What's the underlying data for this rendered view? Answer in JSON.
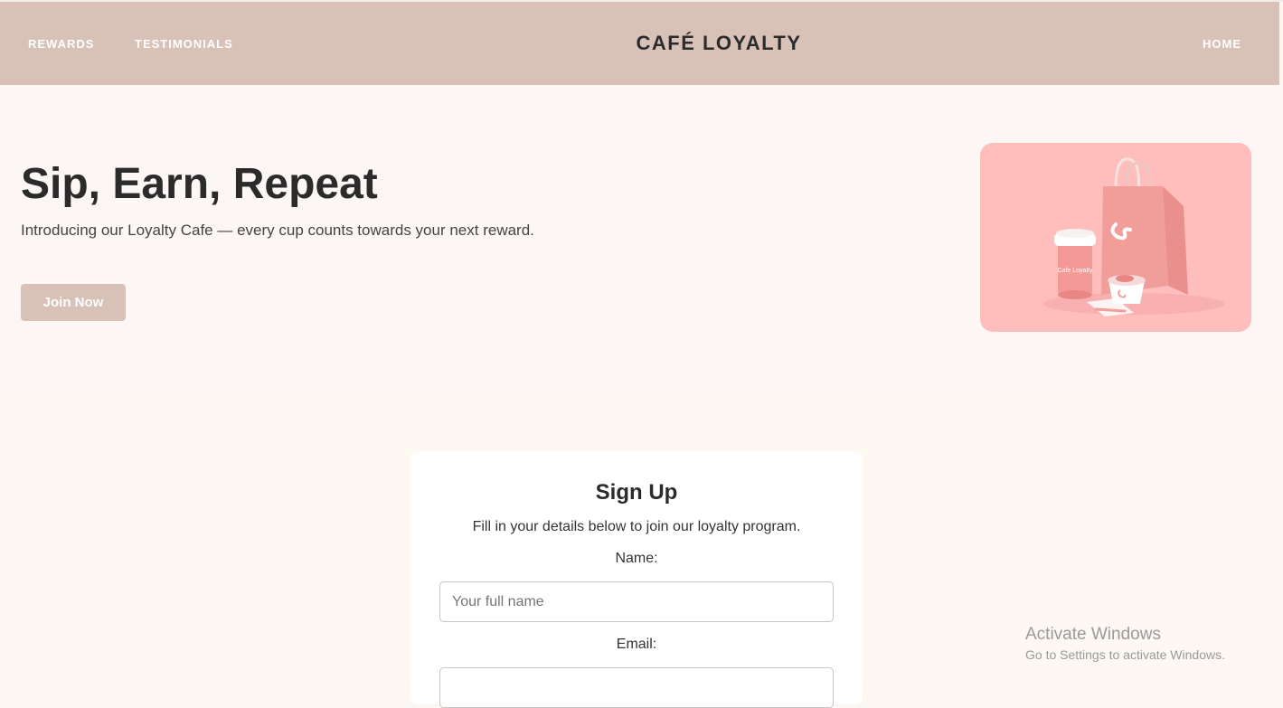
{
  "nav": {
    "rewards": "REWARDS",
    "testimonials": "TESTIMONIALS",
    "brand": "CAFÉ LOYALTY",
    "home": "HOME"
  },
  "hero": {
    "title": "Sip, Earn, Repeat",
    "subtitle": "Introducing our Loyalty Cafe — every cup counts towards your next reward.",
    "cta": "Join Now",
    "image_alt": "pink-cafe-merchandise-image",
    "cup_text": "Cafe Loyalty",
    "image_bg": "#ffbdbb"
  },
  "signup": {
    "title": "Sign Up",
    "description": "Fill in your details below to join our loyalty program.",
    "name_label": "Name:",
    "name_placeholder": "Your full name",
    "email_label": "Email:",
    "email_placeholder": ""
  },
  "watermark": {
    "line1": "Activate Windows",
    "line2": "Go to Settings to activate Windows."
  },
  "colors": {
    "header_bg": "#d8c2b8",
    "page_bg": "#fcf7f4",
    "accent": "#d8c2b8"
  }
}
